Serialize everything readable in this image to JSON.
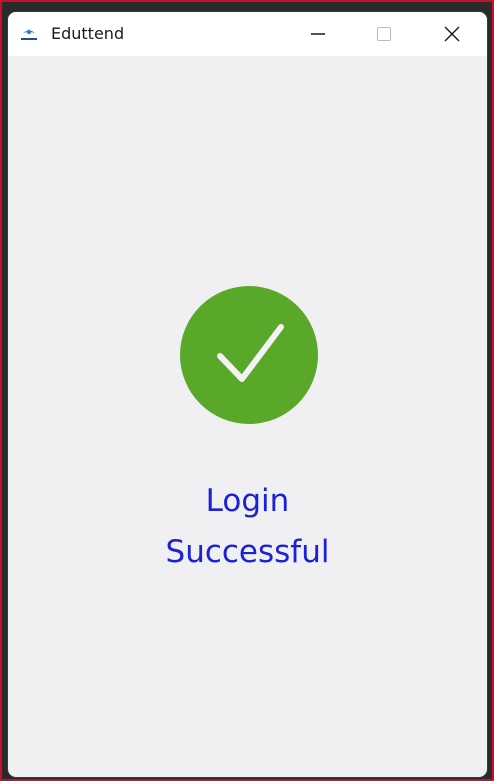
{
  "window": {
    "title": "Eduttend",
    "app_icon": "eduttend-logo-icon",
    "controls": {
      "minimize_icon": "minimize-icon",
      "maximize_icon": "maximize-icon",
      "close_icon": "close-icon"
    }
  },
  "main": {
    "status_icon": "check-icon",
    "message_line1": "Login",
    "message_line2": "Successful"
  },
  "colors": {
    "accent_green": "#5aa829",
    "message_blue": "#1c22d4",
    "background": "#f0eff2"
  }
}
